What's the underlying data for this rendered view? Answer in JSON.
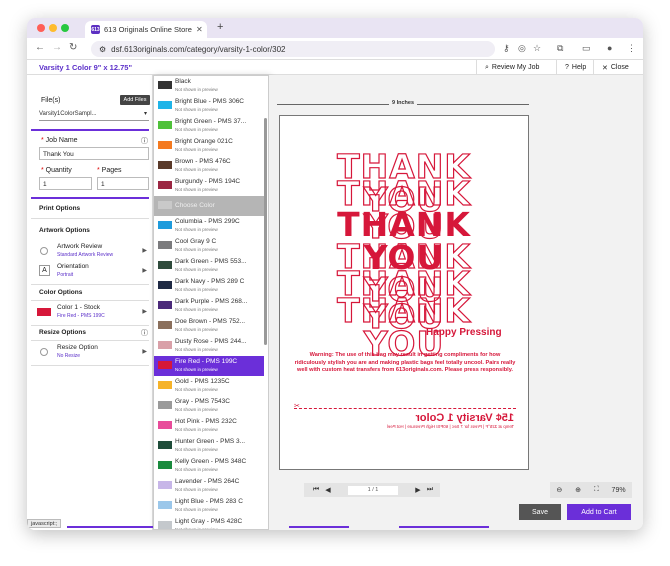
{
  "browser": {
    "tab_title": "613 Originals Online Storefro",
    "tab_favicon": "613",
    "url": "dsf.613originals.com/category/varsity-1-color/302",
    "status_text": "javascript:;"
  },
  "header": {
    "title": "Varsity 1 Color 9\" x 12.75\"",
    "review_label": "Review My Job",
    "help_label": "Help",
    "close_label": "Close"
  },
  "left_panel": {
    "files_label": "File(s)",
    "add_files_label": "Add Files",
    "file_value": "Varsity1ColorSampl...",
    "job_name_label": "Job Name",
    "job_name_value": "Thank You",
    "quantity_label": "Quantity",
    "quantity_value": "1",
    "pages_label": "Pages",
    "pages_value": "1",
    "print_options_label": "Print Options",
    "artwork_options_label": "Artwork Options",
    "artwork_review_label": "Artwork Review",
    "artwork_review_sub": "Standard Artwork Review",
    "orientation_label": "Orientation",
    "orientation_sub": "Portrait",
    "color_options_label": "Color Options",
    "color_label": "Color 1 - Stock",
    "color_sub": "Fire Red - PMS 199C",
    "resize_options_label": "Resize Options",
    "resize_label": "Resize Option",
    "resize_sub": "No Resize"
  },
  "dropdown": {
    "note": "Not shown in preview",
    "items": [
      {
        "name": "Black",
        "color": "#333333"
      },
      {
        "name": "Bright Blue - PMS 306C",
        "color": "#1fb4e8"
      },
      {
        "name": "Bright Green - PMS 37...",
        "color": "#4fc13a"
      },
      {
        "name": "Bright Orange 021C",
        "color": "#f47a20"
      },
      {
        "name": "Brown - PMS 476C",
        "color": "#5a3a2a"
      },
      {
        "name": "Burgundy - PMS 194C",
        "color": "#9b2743"
      },
      {
        "name": "Choose Color",
        "color": "#c9c9c9"
      },
      {
        "name": "Columbia - PMS 299C",
        "color": "#1e9bdc"
      },
      {
        "name": "Cool Gray 9 C",
        "color": "#7b7b7d"
      },
      {
        "name": "Dark Green - PMS 553...",
        "color": "#2f4b3c"
      },
      {
        "name": "Dark Navy - PMS 289 C",
        "color": "#1f2a44"
      },
      {
        "name": "Dark Purple - PMS 268...",
        "color": "#4b2a7a"
      },
      {
        "name": "Doe Brown - PMS 752...",
        "color": "#8a6f5c"
      },
      {
        "name": "Dusty Rose - PMS 244...",
        "color": "#d9a0a8"
      },
      {
        "name": "Fire Red - PMS 199C",
        "color": "#d6173a"
      },
      {
        "name": "Gold - PMS 1235C",
        "color": "#f6b32a"
      },
      {
        "name": "Gray - PMS 7543C",
        "color": "#9a9a9a"
      },
      {
        "name": "Hot Pink - PMS 232C",
        "color": "#e84c9a"
      },
      {
        "name": "Hunter Green - PMS 3...",
        "color": "#1f4d3a"
      },
      {
        "name": "Kelly Green - PMS 348C",
        "color": "#1a8a3e"
      },
      {
        "name": "Lavender - PMS 264C",
        "color": "#c7b6e8"
      },
      {
        "name": "Light Blue - PMS 283 C",
        "color": "#9bc7ea"
      },
      {
        "name": "Light Gray - PMS 428C",
        "color": "#c4c8cc"
      }
    ]
  },
  "preview": {
    "ruler_label": "9 Inches",
    "line": "THANK YOU",
    "happy": "Happy Pressing",
    "warning_bold": "Warning:",
    "warning_text": "The use of this bag may result in getting compliments for how ridiculously stylish you are and making plastic bags feel totally uncool. Pairs really well with custom heat transfers from 613originals.com. Please press responsibly.",
    "mirror_big": "15¢ Varsity 1 Color",
    "mirror_small": "Temp at 325°F | Press for 7 Sec | 60PSI High Pressure | Hot Peel",
    "accent": "#d6173a"
  },
  "controls": {
    "page_indicator": "1 / 1",
    "zoom_level": "79%",
    "save_label": "Save",
    "cart_label": "Add to Cart"
  }
}
